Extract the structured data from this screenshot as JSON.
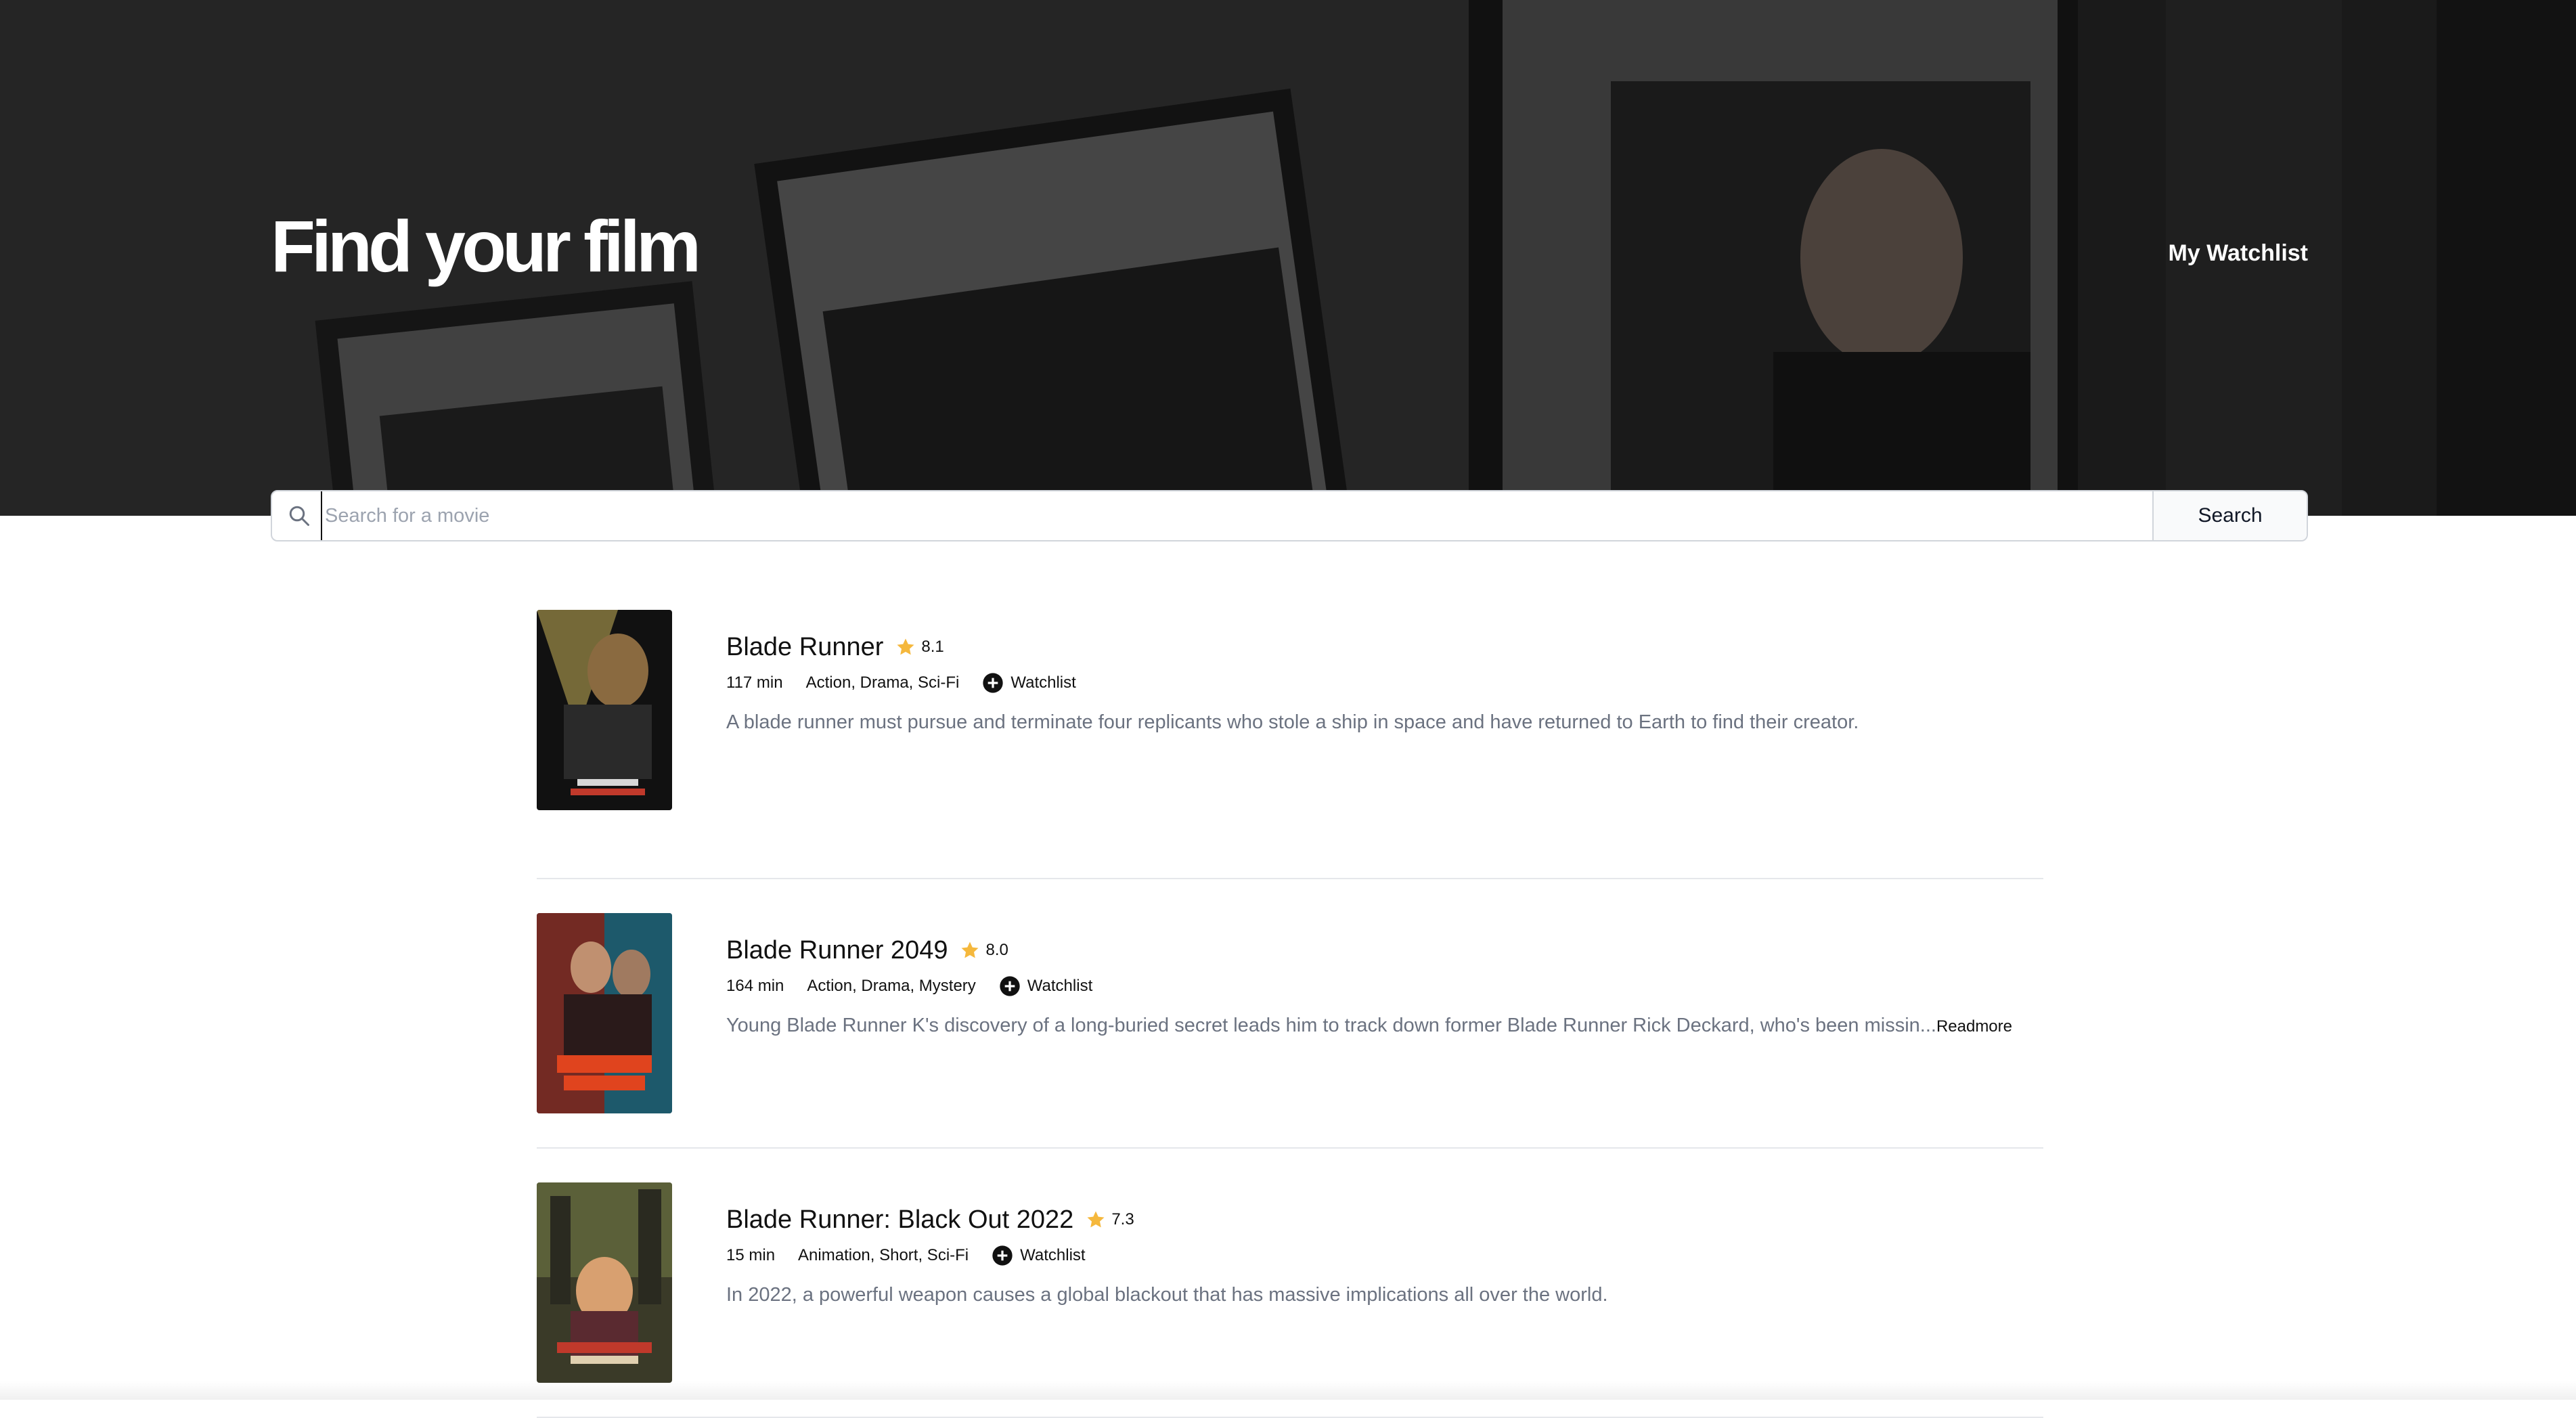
{
  "header": {
    "title": "Find your film",
    "watchlist_link": "My Watchlist"
  },
  "search": {
    "placeholder": "Search for a movie",
    "button_label": "Search"
  },
  "movies": [
    {
      "title": "Blade Runner",
      "rating": "8.1",
      "runtime": "117 min",
      "genres": "Action, Drama, Sci-Fi",
      "watchlist_label": "Watchlist",
      "description": "A blade runner must pursue and terminate four replicants who stole a ship in space and have returned to Earth to find their creator.",
      "readmore": ""
    },
    {
      "title": "Blade Runner 2049",
      "rating": "8.0",
      "runtime": "164 min",
      "genres": "Action, Drama, Mystery",
      "watchlist_label": "Watchlist",
      "description": "Young Blade Runner K's discovery of a long-buried secret leads him to track down former Blade Runner Rick Deckard, who's been missin...",
      "readmore": "Readmore"
    },
    {
      "title": "Blade Runner: Black Out 2022",
      "rating": "7.3",
      "runtime": "15 min",
      "genres": "Animation, Short, Sci-Fi",
      "watchlist_label": "Watchlist",
      "description": "In 2022, a powerful weapon causes a global blackout that has massive implications all over the world.",
      "readmore": ""
    }
  ],
  "colors": {
    "star": "#f5b83d",
    "text_primary": "#111111",
    "text_muted": "#6b7280",
    "border": "#d1d5db"
  }
}
